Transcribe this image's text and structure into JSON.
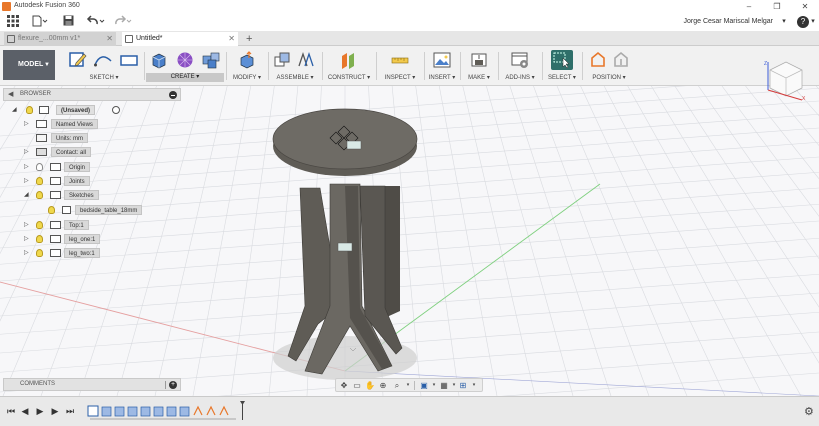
{
  "window": {
    "title": "Autodesk Fusion 360",
    "minimize": "–",
    "maximize": "❐",
    "close": "✕"
  },
  "qbar": {
    "user_name": "Jorge Cesar Mariscal Melgar",
    "help": "?"
  },
  "tabs": [
    {
      "label": "flexure_...00mm v1*",
      "active": false
    },
    {
      "label": "Untitled*",
      "active": true
    }
  ],
  "ribbon": {
    "workspace": "MODEL",
    "groups": [
      {
        "label": "SKETCH ▾"
      },
      {
        "label": "CREATE ▾"
      },
      {
        "label": "MODIFY ▾"
      },
      {
        "label": "ASSEMBLE ▾"
      },
      {
        "label": "CONSTRUCT ▾"
      },
      {
        "label": "INSPECT ▾"
      },
      {
        "label": "INSERT ▾"
      },
      {
        "label": "MAKE ▾"
      },
      {
        "label": "ADD-INS ▾"
      },
      {
        "label": "SELECT ▾"
      },
      {
        "label": "POSITION ▾"
      }
    ]
  },
  "browser": {
    "title": "BROWSER",
    "items": [
      {
        "label": "(Unsaved)"
      },
      {
        "label": "Named Views"
      },
      {
        "label": "Units: mm"
      },
      {
        "label": "Contact: all"
      },
      {
        "label": "Origin"
      },
      {
        "label": "Joints"
      },
      {
        "label": "Sketches"
      },
      {
        "label": "bedside_table_18mm"
      },
      {
        "label": "Top:1"
      },
      {
        "label": "leg_one:1"
      },
      {
        "label": "leg_two:1"
      }
    ]
  },
  "comments": {
    "title": "COMMENTS",
    "add": "+"
  },
  "colors": {
    "model": "#5f5c56",
    "accent": "#e8772a",
    "select_active": "#2f6f6a"
  }
}
